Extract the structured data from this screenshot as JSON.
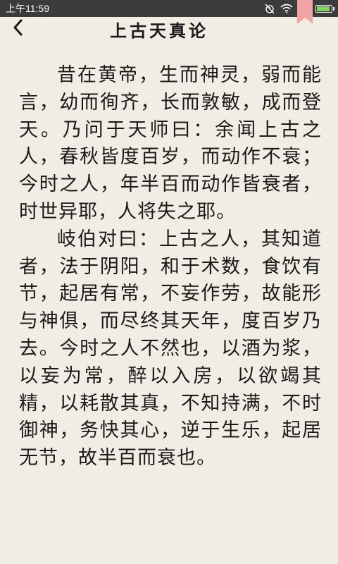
{
  "status_bar": {
    "time": "上午11:59",
    "icons": [
      "alarm-off-icon",
      "wifi-icon",
      "signal-icon",
      "battery-icon"
    ],
    "battery_level": 0.9
  },
  "header": {
    "title": "上古天真论",
    "back_icon": "chevron-left-icon"
  },
  "bookmark": {
    "icon": "bookmark-ribbon-icon",
    "color": "#f2a4a4"
  },
  "content": {
    "paragraphs": [
      "昔在黄帝，生而神灵，弱而能言，幼而徇齐，长而敦敏，成而登天。乃问于天师曰：余闻上古之人，春秋皆度百岁，而动作不衰；今时之人，年半百而动作皆衰者，时世异耶，人将失之耶。",
      "岐伯对曰：上古之人，其知道者，法于阴阳，和于术数，食饮有节，起居有常，不妄作劳，故能形与神俱，而尽终其天年，度百岁乃去。今时之人不然也，以酒为浆，以妄为常，醉以入房，以欲竭其精，以耗散其真，不知持满，不时御神，务快其心，逆于生乐，起居无节，故半百而衰也。"
    ]
  },
  "colors": {
    "background": "#f1ede4",
    "status_bar": "#3b3b3b",
    "text": "#1a1a1a"
  }
}
